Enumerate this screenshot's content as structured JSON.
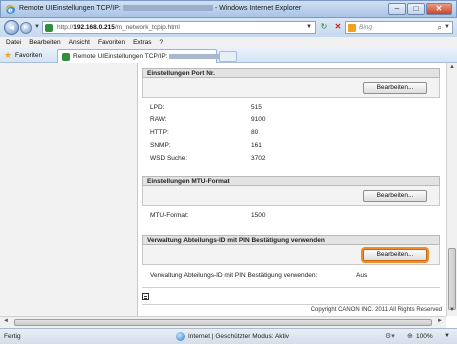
{
  "window": {
    "title_prefix": "Remote UIEinstellungen TCP/IP:",
    "title_suffix": "- Windows Internet Explorer",
    "minimize": "–",
    "maximize": "□",
    "close": "✕"
  },
  "nav": {
    "back_glyph": "◄",
    "forward_glyph": "►",
    "url_prefix": "http://",
    "url_host": "192.168.0.215",
    "url_path": "/m_network_tcpip.html",
    "refresh_glyph": "↻",
    "stop_glyph": "✕",
    "search_placeholder": "Bing"
  },
  "menu": [
    "Datei",
    "Bearbeiten",
    "Ansicht",
    "Favoriten",
    "Extras",
    "?"
  ],
  "favorites": {
    "label": "Favoriten",
    "tab_label": "Remote UIEinstellungen TCP/IP:"
  },
  "sections": {
    "port": {
      "header": "Einstellungen Port Nr.",
      "button": "Bearbeiten...",
      "rows": [
        {
          "label": "LPD:",
          "value": "515"
        },
        {
          "label": "RAW:",
          "value": "9100"
        },
        {
          "label": "HTTP:",
          "value": "80"
        },
        {
          "label": "SNMP:",
          "value": "161"
        },
        {
          "label": "WSD Suche:",
          "value": "3702"
        }
      ]
    },
    "mtu": {
      "header": "Einstellungen MTU-Format",
      "button": "Bearbeiten...",
      "label": "MTU-Format:",
      "value": "1500"
    },
    "dept": {
      "header": "Verwaltung Abteilungs-ID mit PIN Bestätigung verwenden",
      "button": "Bearbeiten...",
      "label": "Verwaltung Abteilungs-ID mit PIN Bestätigung verwenden:",
      "value": "Aus"
    }
  },
  "footer": {
    "copyright": "Copyright CANON INC. 2011 All Rights Reserved"
  },
  "status": {
    "left": "Fertig",
    "zone": "Internet | Geschützter Modus: Aktiv",
    "zoom": "100%"
  },
  "colors": {
    "highlight": "#ee8b2a",
    "section_header_bg": "#e3e3e3",
    "titlebar": "#a9c4e6"
  }
}
